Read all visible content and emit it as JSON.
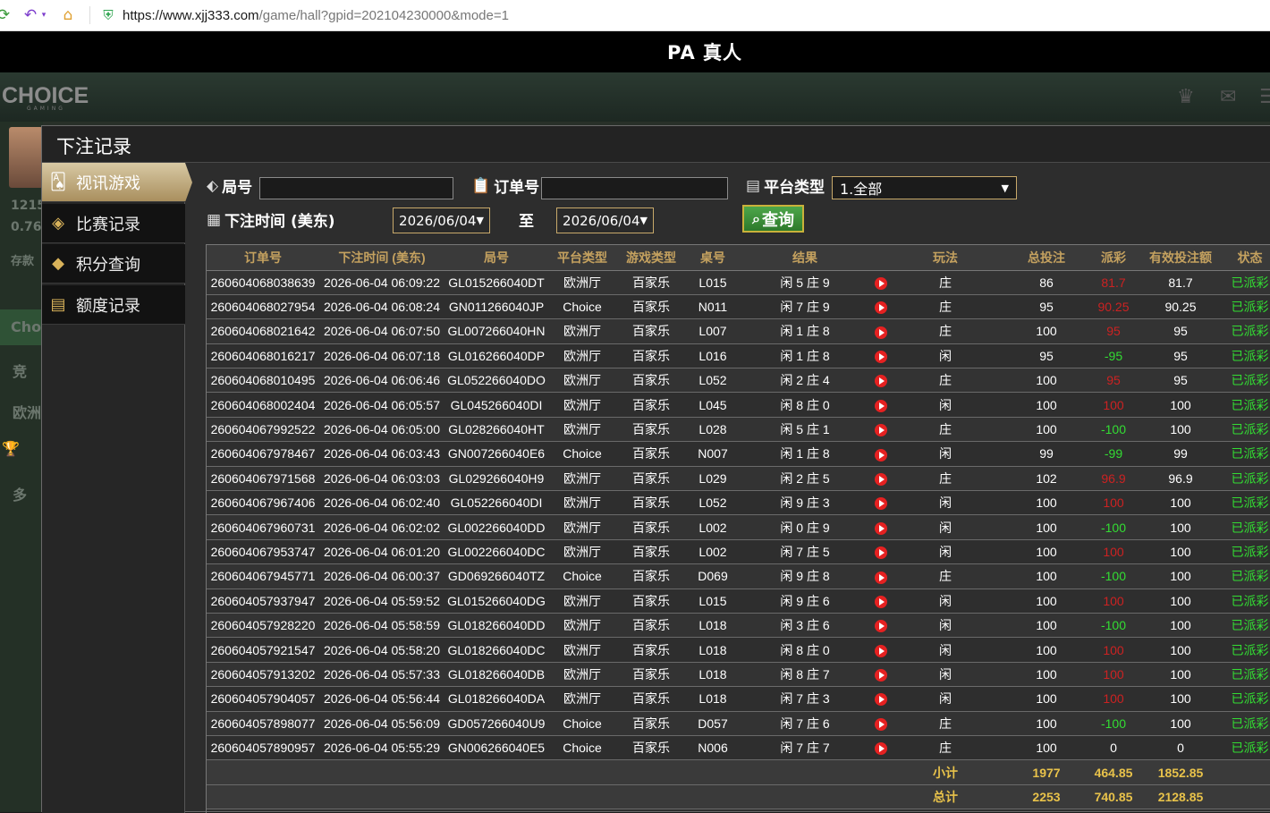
{
  "browser": {
    "url_host": "https://www.xjj333.com",
    "url_path": "/game/hall?gpid=202104230000&mode=1"
  },
  "title_bar": {
    "title": "PA 真人"
  },
  "app_header": {
    "logo": "CHOICE",
    "logo_sub": "GAMING"
  },
  "background": {
    "balance1": "1215",
    "balance2": "0.76",
    "deposit": "存款",
    "menu": [
      "竞",
      "欧洲",
      "多"
    ],
    "green_label": "Cho"
  },
  "modal": {
    "title": "下注记录",
    "sidebar": [
      {
        "label": "视讯游戏",
        "icon": "cards-icon",
        "active": true
      },
      {
        "label": "比赛记录",
        "icon": "ticket-icon",
        "active": false
      },
      {
        "label": "积分查询",
        "icon": "diamond-icon",
        "active": false
      },
      {
        "label": "额度记录",
        "icon": "document-icon",
        "active": false
      }
    ],
    "filters": {
      "round_label": "局号",
      "round_value": "",
      "order_label": "订单号",
      "order_value": "",
      "platform_label": "平台类型",
      "platform_value": "1.全部",
      "time_label": "下注时间 (美东)",
      "date_from": "2026/06/04",
      "date_to": "2026/06/04",
      "to_label": "至",
      "query_label": "查询"
    },
    "table": {
      "headers": [
        "订单号",
        "下注时间 (美东)",
        "局号",
        "平台类型",
        "游戏类型",
        "桌号",
        "结果",
        "",
        "玩法",
        "总投注",
        "派彩",
        "有效投注额",
        "状态"
      ],
      "rows": [
        [
          "260604068038639",
          "2026-06-04 06:09:22",
          "GL015266040DT",
          "欧洲厅",
          "百家乐",
          "L015",
          "闲 5 庄 9",
          "庄",
          "86",
          "81.7",
          "81.7",
          "已派彩"
        ],
        [
          "260604068027954",
          "2026-06-04 06:08:24",
          "GN011266040JP",
          "Choice",
          "百家乐",
          "N011",
          "闲 7 庄 9",
          "庄",
          "95",
          "90.25",
          "90.25",
          "已派彩"
        ],
        [
          "260604068021642",
          "2026-06-04 06:07:50",
          "GL007266040HN",
          "欧洲厅",
          "百家乐",
          "L007",
          "闲 1 庄 8",
          "庄",
          "100",
          "95",
          "95",
          "已派彩"
        ],
        [
          "260604068016217",
          "2026-06-04 06:07:18",
          "GL016266040DP",
          "欧洲厅",
          "百家乐",
          "L016",
          "闲 1 庄 8",
          "闲",
          "95",
          "-95",
          "95",
          "已派彩"
        ],
        [
          "260604068010495",
          "2026-06-04 06:06:46",
          "GL052266040DO",
          "欧洲厅",
          "百家乐",
          "L052",
          "闲 2 庄 4",
          "庄",
          "100",
          "95",
          "95",
          "已派彩"
        ],
        [
          "260604068002404",
          "2026-06-04 06:05:57",
          "GL045266040DI",
          "欧洲厅",
          "百家乐",
          "L045",
          "闲 8 庄 0",
          "闲",
          "100",
          "100",
          "100",
          "已派彩"
        ],
        [
          "260604067992522",
          "2026-06-04 06:05:00",
          "GL028266040HT",
          "欧洲厅",
          "百家乐",
          "L028",
          "闲 5 庄 1",
          "庄",
          "100",
          "-100",
          "100",
          "已派彩"
        ],
        [
          "260604067978467",
          "2026-06-04 06:03:43",
          "GN007266040E6",
          "Choice",
          "百家乐",
          "N007",
          "闲 1 庄 8",
          "闲",
          "99",
          "-99",
          "99",
          "已派彩"
        ],
        [
          "260604067971568",
          "2026-06-04 06:03:03",
          "GL029266040H9",
          "欧洲厅",
          "百家乐",
          "L029",
          "闲 2 庄 5",
          "庄",
          "102",
          "96.9",
          "96.9",
          "已派彩"
        ],
        [
          "260604067967406",
          "2026-06-04 06:02:40",
          "GL052266040DI",
          "欧洲厅",
          "百家乐",
          "L052",
          "闲 9 庄 3",
          "闲",
          "100",
          "100",
          "100",
          "已派彩"
        ],
        [
          "260604067960731",
          "2026-06-04 06:02:02",
          "GL002266040DD",
          "欧洲厅",
          "百家乐",
          "L002",
          "闲 0 庄 9",
          "闲",
          "100",
          "-100",
          "100",
          "已派彩"
        ],
        [
          "260604067953747",
          "2026-06-04 06:01:20",
          "GL002266040DC",
          "欧洲厅",
          "百家乐",
          "L002",
          "闲 7 庄 5",
          "闲",
          "100",
          "100",
          "100",
          "已派彩"
        ],
        [
          "260604067945771",
          "2026-06-04 06:00:37",
          "GD069266040TZ",
          "Choice",
          "百家乐",
          "D069",
          "闲 9 庄 8",
          "庄",
          "100",
          "-100",
          "100",
          "已派彩"
        ],
        [
          "260604057937947",
          "2026-06-04 05:59:52",
          "GL015266040DG",
          "欧洲厅",
          "百家乐",
          "L015",
          "闲 9 庄 6",
          "闲",
          "100",
          "100",
          "100",
          "已派彩"
        ],
        [
          "260604057928220",
          "2026-06-04 05:58:59",
          "GL018266040DD",
          "欧洲厅",
          "百家乐",
          "L018",
          "闲 3 庄 6",
          "闲",
          "100",
          "-100",
          "100",
          "已派彩"
        ],
        [
          "260604057921547",
          "2026-06-04 05:58:20",
          "GL018266040DC",
          "欧洲厅",
          "百家乐",
          "L018",
          "闲 8 庄 0",
          "闲",
          "100",
          "100",
          "100",
          "已派彩"
        ],
        [
          "260604057913202",
          "2026-06-04 05:57:33",
          "GL018266040DB",
          "欧洲厅",
          "百家乐",
          "L018",
          "闲 8 庄 7",
          "闲",
          "100",
          "100",
          "100",
          "已派彩"
        ],
        [
          "260604057904057",
          "2026-06-04 05:56:44",
          "GL018266040DA",
          "欧洲厅",
          "百家乐",
          "L018",
          "闲 7 庄 3",
          "闲",
          "100",
          "100",
          "100",
          "已派彩"
        ],
        [
          "260604057898077",
          "2026-06-04 05:56:09",
          "GD057266040U9",
          "Choice",
          "百家乐",
          "D057",
          "闲 7 庄 6",
          "庄",
          "100",
          "-100",
          "100",
          "已派彩"
        ],
        [
          "260604057890957",
          "2026-06-04 05:55:29",
          "GN006266040E5",
          "Choice",
          "百家乐",
          "N006",
          "闲 7 庄 7",
          "庄",
          "100",
          "0",
          "0",
          "已派彩"
        ]
      ],
      "subtotal": {
        "label": "小计",
        "total_bet": "1977",
        "payout": "464.85",
        "valid": "1852.85"
      },
      "total": {
        "label": "总计",
        "total_bet": "2253",
        "payout": "740.85",
        "valid": "2128.85"
      }
    }
  },
  "colors": {
    "payout_positive": "#cc2222",
    "payout_negative": "#33dd33",
    "status": "#33dd33",
    "header_gold": "#c4a15f",
    "total_gold": "#e8c24a"
  }
}
